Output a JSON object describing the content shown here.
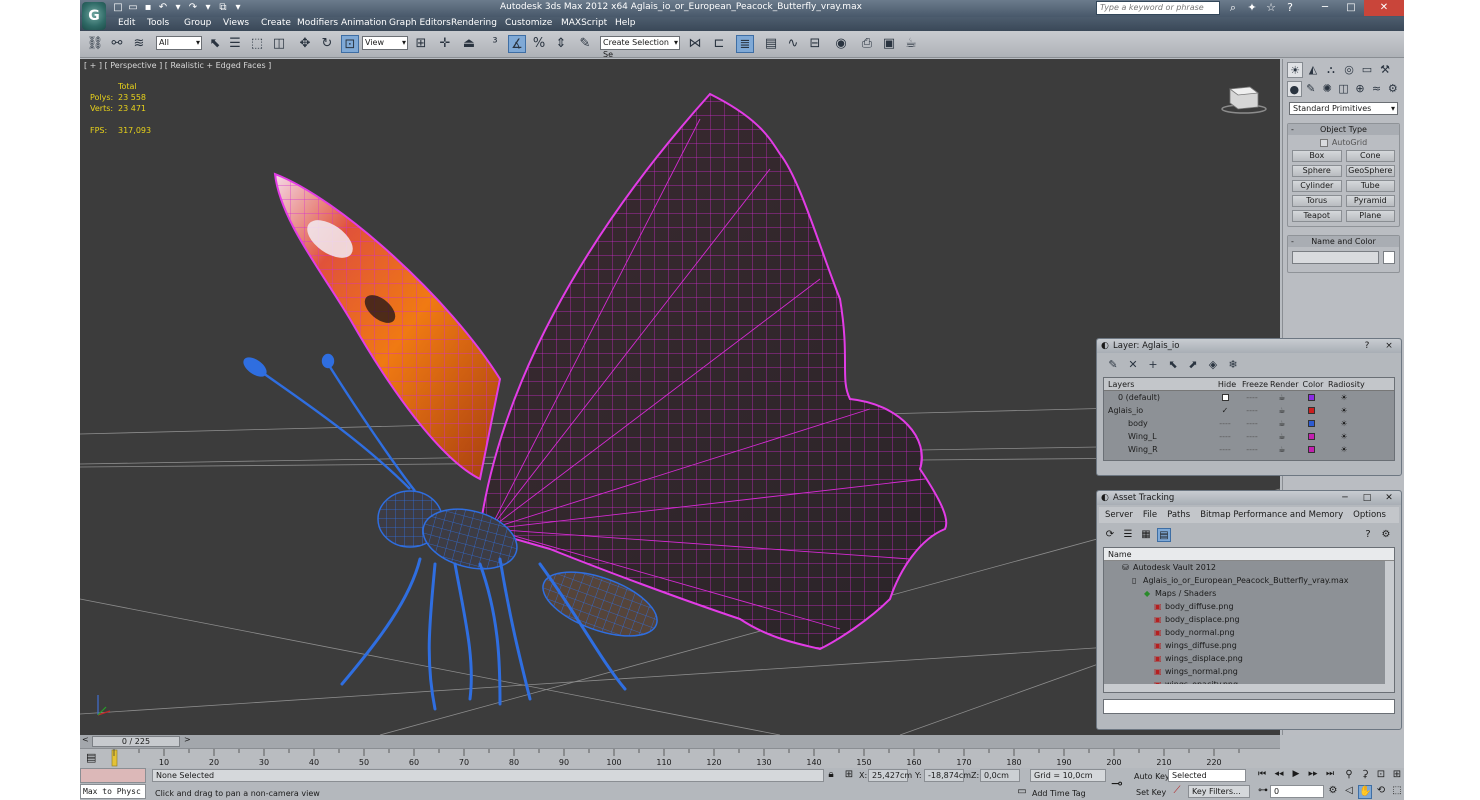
{
  "app": {
    "logo_text": "G",
    "title": "Autodesk 3ds Max  2012 x64     Aglais_io_or_European_Peacock_Butterfly_vray.max",
    "search_placeholder": "Type a keyword or phrase"
  },
  "menu": [
    "Edit",
    "Tools",
    "Group",
    "Views",
    "Create",
    "Modifiers",
    "Animation",
    "Graph Editors",
    "Rendering",
    "Customize",
    "MAXScript",
    "Help"
  ],
  "toolbar": {
    "filter_value": "All",
    "ref_coord_value": "View",
    "named_selection_placeholder": "Create Selection Se"
  },
  "viewport": {
    "label": "[ + ] [ Perspective ] [ Realistic + Edged Faces ]",
    "stats": {
      "header": "Total",
      "polys_label": "Polys:",
      "polys_value": "23 558",
      "verts_label": "Verts:",
      "verts_value": "23 471",
      "fps_label": "FPS:",
      "fps_value": "317,093"
    }
  },
  "command_panel": {
    "category_value": "Standard Primitives",
    "object_type_title": "Object Type",
    "autogrid_label": "AutoGrid",
    "primitives": [
      "Box",
      "Cone",
      "Sphere",
      "GeoSphere",
      "Cylinder",
      "Tube",
      "Torus",
      "Pyramid",
      "Teapot",
      "Plane"
    ],
    "name_color_title": "Name and Color"
  },
  "layer_dialog": {
    "title": "Layer: Aglais_io",
    "help": "?",
    "close": "×",
    "columns": [
      "Layers",
      "Hide",
      "Freeze",
      "Render",
      "Color",
      "Radiosity"
    ],
    "rows": [
      {
        "name": "0 (default)",
        "indent": 1,
        "color": "#8a2be2"
      },
      {
        "name": "Aglais_io",
        "indent": 0,
        "color": "#cc1f1f"
      },
      {
        "name": "body",
        "indent": 2,
        "color": "#2d5bd1"
      },
      {
        "name": "Wing_L",
        "indent": 2,
        "color": "#c21fb0"
      },
      {
        "name": "Wing_R",
        "indent": 2,
        "color": "#c21fb0"
      }
    ]
  },
  "asset_tracking": {
    "title": "Asset Tracking",
    "menu": [
      "Server",
      "File",
      "Paths",
      "Bitmap Performance and Memory",
      "Options"
    ],
    "column": "Name",
    "rows": [
      {
        "label": "Autodesk Vault 2012",
        "indent": 1
      },
      {
        "label": "Aglais_io_or_European_Peacock_Butterfly_vray.max",
        "indent": 2
      },
      {
        "label": "Maps / Shaders",
        "indent": 3
      },
      {
        "label": "body_diffuse.png",
        "indent": 4
      },
      {
        "label": "body_displace.png",
        "indent": 4
      },
      {
        "label": "body_normal.png",
        "indent": 4
      },
      {
        "label": "wings_diffuse.png",
        "indent": 4
      },
      {
        "label": "wings_displace.png",
        "indent": 4
      },
      {
        "label": "wings_normal.png",
        "indent": 4
      },
      {
        "label": "wings_opacity.png",
        "indent": 4
      }
    ]
  },
  "timeline": {
    "frame_display": "0 / 225",
    "ticks": [
      "0",
      "10",
      "20",
      "30",
      "40",
      "50",
      "60",
      "70",
      "80",
      "90",
      "100",
      "110",
      "120",
      "130",
      "140",
      "150",
      "160",
      "170",
      "180",
      "190",
      "200",
      "210",
      "220"
    ]
  },
  "status": {
    "listener_text": "Max to Physc",
    "selection": "None Selected",
    "prompt": "Click and drag to pan a non-camera view",
    "x_label": "X:",
    "x_value": "25,427cm",
    "y_label": "Y:",
    "y_value": "-18,874cm",
    "z_label": "Z:",
    "z_value": "0,0cm",
    "grid": "Grid = 10,0cm",
    "add_time_tag": "Add Time Tag",
    "auto_key": "Auto Key",
    "set_key": "Set Key",
    "selected_value": "Selected",
    "key_filters": "Key Filters...",
    "frame_value": "0"
  }
}
